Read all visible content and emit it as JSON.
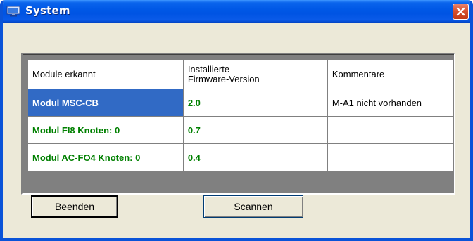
{
  "window": {
    "title": "System",
    "icon": "computer-monitor-icon",
    "close_icon": "close-icon"
  },
  "table": {
    "headers": [
      "Module erkannt",
      "Installierte Firmware-Version",
      "Kommentare"
    ],
    "header_firmware_line1": "Installierte",
    "header_firmware_line2": "Firmware-Version",
    "rows": [
      {
        "module": "Modul MSC-CB",
        "firmware": "2.0",
        "comment": "M-A1 nicht vorhanden",
        "selected": true
      },
      {
        "module": "Modul FI8 Knoten: 0",
        "firmware": "0.7",
        "comment": "",
        "selected": false
      },
      {
        "module": "Modul AC-FO4 Knoten: 0",
        "firmware": "0.4",
        "comment": "",
        "selected": false
      }
    ]
  },
  "buttons": {
    "quit_label": "Beenden",
    "scan_label": "Scannen"
  },
  "colors": {
    "title_bar": "#0054e3",
    "module_text": "#008000",
    "selection": "#316ac5",
    "dialog_bg": "#ece9d8"
  }
}
